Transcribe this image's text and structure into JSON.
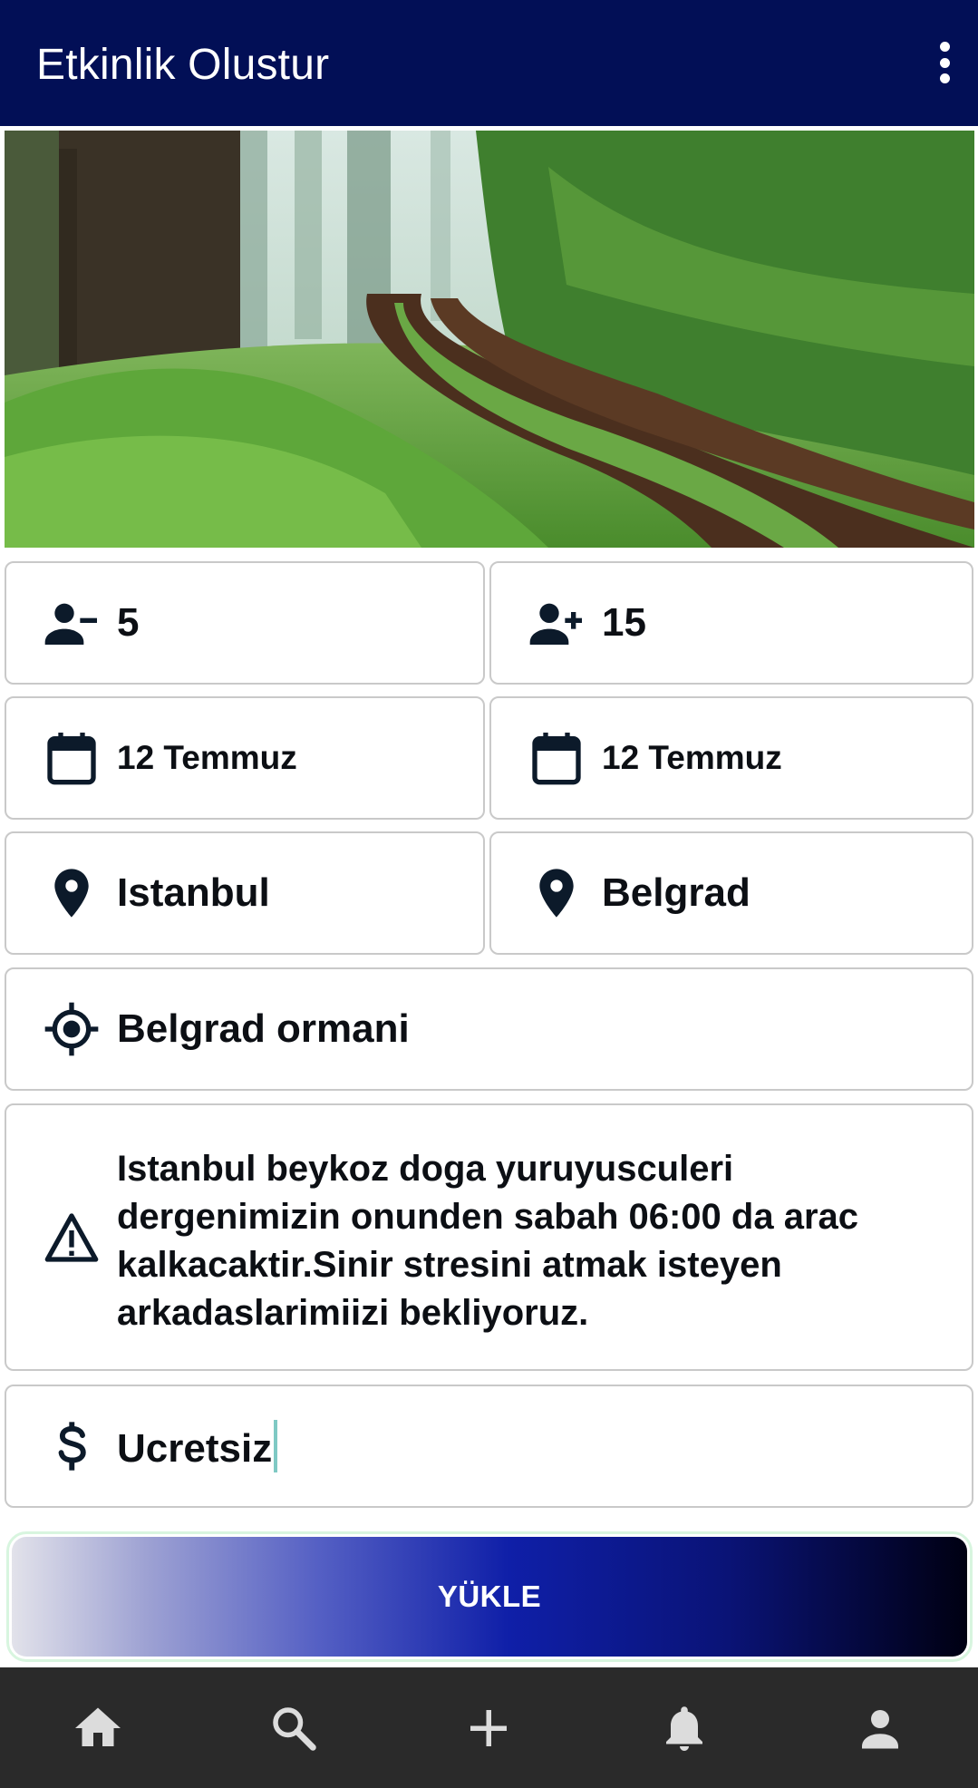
{
  "appbar": {
    "title": "Etkinlik Olustur",
    "menu_icon": "more-vert-icon"
  },
  "hero_image": {
    "subject": "forest-trail-photo"
  },
  "colors": {
    "appbar": "#020f56",
    "nav_bg": "#2a2a2a",
    "text": "#0c0f14",
    "border": "#c9c9c9"
  },
  "form": {
    "min_participants": "5",
    "max_participants": "15",
    "start_date": "12 Temmuz",
    "end_date": "12 Temmuz",
    "city_from": "Istanbul",
    "city_to": "Belgrad",
    "meeting_point": "Belgrad ormani",
    "description": "Istanbul beykoz doga yuruyusculeri dergenimizin onunden  sabah 06:00 da arac kalkacaktir.Sinir stresini atmak isteyen arkadaslarimiizi bekliyoruz.",
    "price": "Ucretsiz"
  },
  "upload_button": {
    "label": "YÜKLE"
  },
  "bottom_nav": [
    "home-icon",
    "search-icon",
    "add-icon",
    "notifications-icon",
    "profile-icon"
  ]
}
